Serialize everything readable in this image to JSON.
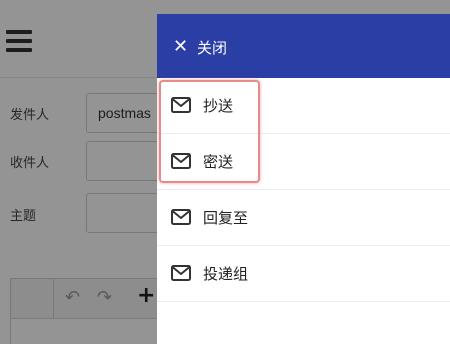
{
  "form": {
    "sender_label": "发件人",
    "sender_value": "postmas",
    "recipient_label": "收件人",
    "subject_label": "主题"
  },
  "drawer": {
    "header_bg": "#2a3ea6",
    "close_label": "关闭",
    "items": [
      {
        "label": "抄送",
        "icon": "mail-icon"
      },
      {
        "label": "密送",
        "icon": "mail-icon"
      },
      {
        "label": "回复至",
        "icon": "mail-icon"
      },
      {
        "label": "投递组",
        "icon": "mail-icon"
      }
    ]
  }
}
